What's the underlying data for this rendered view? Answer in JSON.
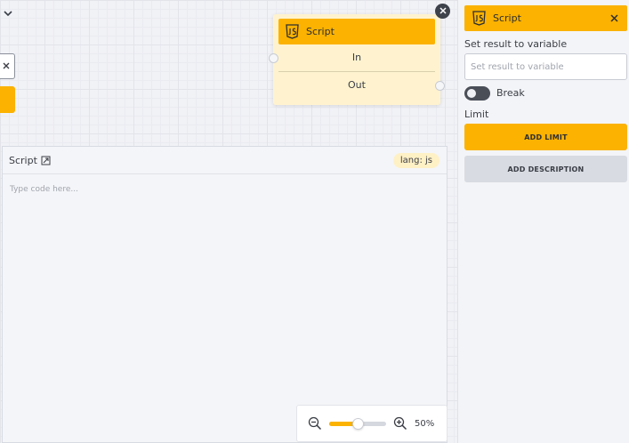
{
  "canvas": {
    "left_controls": {
      "chevron_icon": "chevron-down-icon",
      "close_icon": "close-icon"
    }
  },
  "node": {
    "title": "Script",
    "icon": "js-icon",
    "input_port_label": "In",
    "output_port_label": "Out",
    "close_icon": "close-icon"
  },
  "editor": {
    "title": "Script",
    "expand_icon": "expand-icon",
    "lang_badge": "lang: js",
    "placeholder": "Type code here..."
  },
  "zoom": {
    "zoom_out_icon": "zoom-out-icon",
    "zoom_in_icon": "zoom-in-icon",
    "value_label": "50%",
    "slider_fraction": 0.5
  },
  "panel": {
    "title": "Script",
    "icon": "js-icon",
    "close_icon": "close-icon",
    "set_result_label": "Set result to variable",
    "set_result_placeholder": "Set result to variable",
    "set_result_value": "",
    "break_label": "Break",
    "break_enabled": false,
    "limit_label": "Limit",
    "add_limit_button": "ADD LIMIT",
    "add_description_button": "ADD DESCRIPTION"
  },
  "colors": {
    "accent": "#fbb200",
    "node_body": "#fff3cf",
    "dark": "#3e424b",
    "canvas_bg": "#f1f2f6"
  }
}
